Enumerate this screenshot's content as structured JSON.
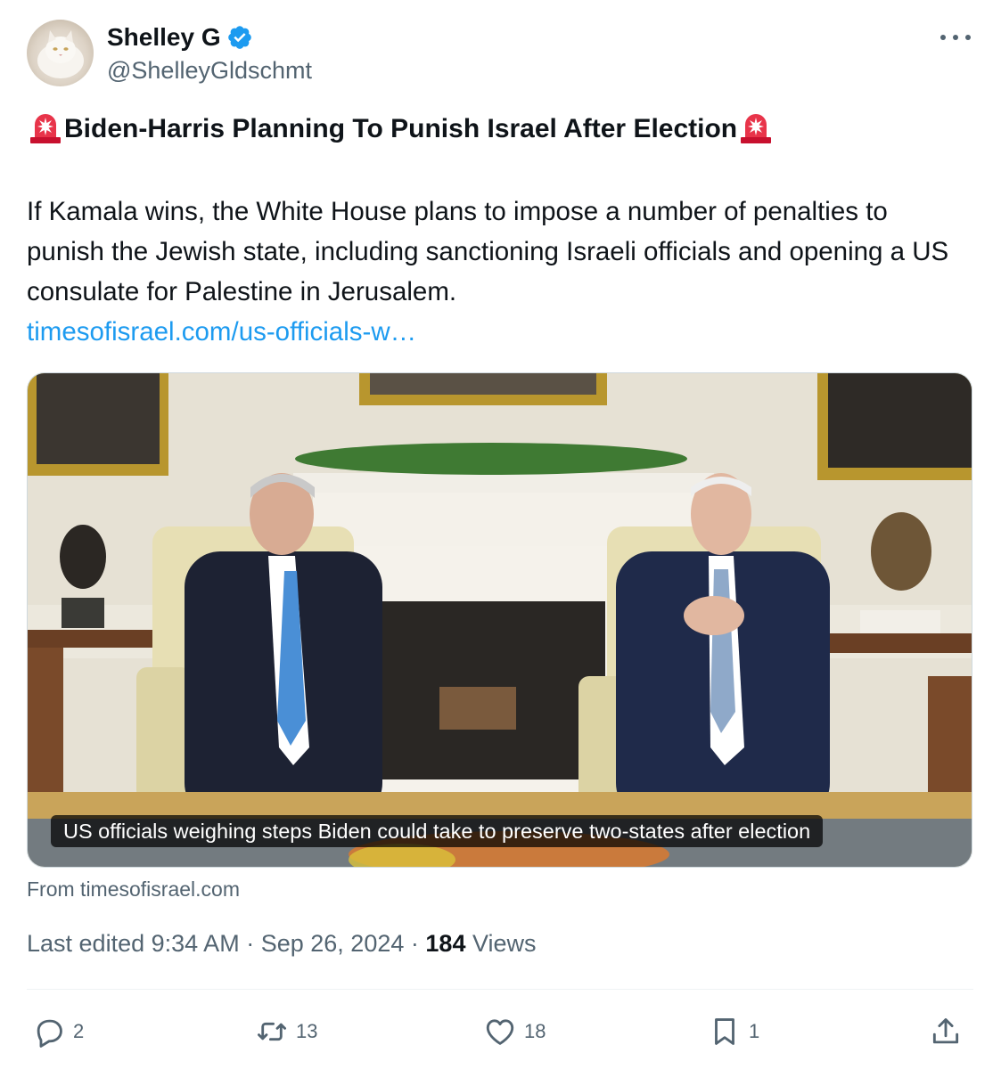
{
  "author": {
    "display_name": "Shelley G",
    "handle": "@ShelleyGldschmt",
    "avatar_icon": "cat-avatar",
    "verified_icon": "verified-badge-icon",
    "verified_color": "#1d9bf0"
  },
  "post": {
    "headline": "Biden-Harris Planning To Punish Israel After Election",
    "headline_emoji_icon": "rotating-light-icon",
    "body": "If Kamala wins, the White House plans to impose a number of penalties to punish the Jewish state, including sanctioning Israeli officials and opening a US consulate for Palestine in Jerusalem.",
    "link_text": "timesofisrael.com/us-officials-w…"
  },
  "link_card": {
    "caption": "US officials weighing steps Biden could take to preserve two-states after election",
    "source": "From timesofisrael.com"
  },
  "meta": {
    "edited_prefix": "Last edited",
    "time": "9:34 AM",
    "separator": "·",
    "date": "Sep 26, 2024",
    "views_count": "184",
    "views_label": "Views"
  },
  "actions": {
    "replies": "2",
    "reposts": "13",
    "likes": "18",
    "bookmarks": "1"
  },
  "colors": {
    "text_primary": "#0f1419",
    "text_secondary": "#536471",
    "link": "#1d9bf0",
    "divider": "#eff3f4"
  }
}
